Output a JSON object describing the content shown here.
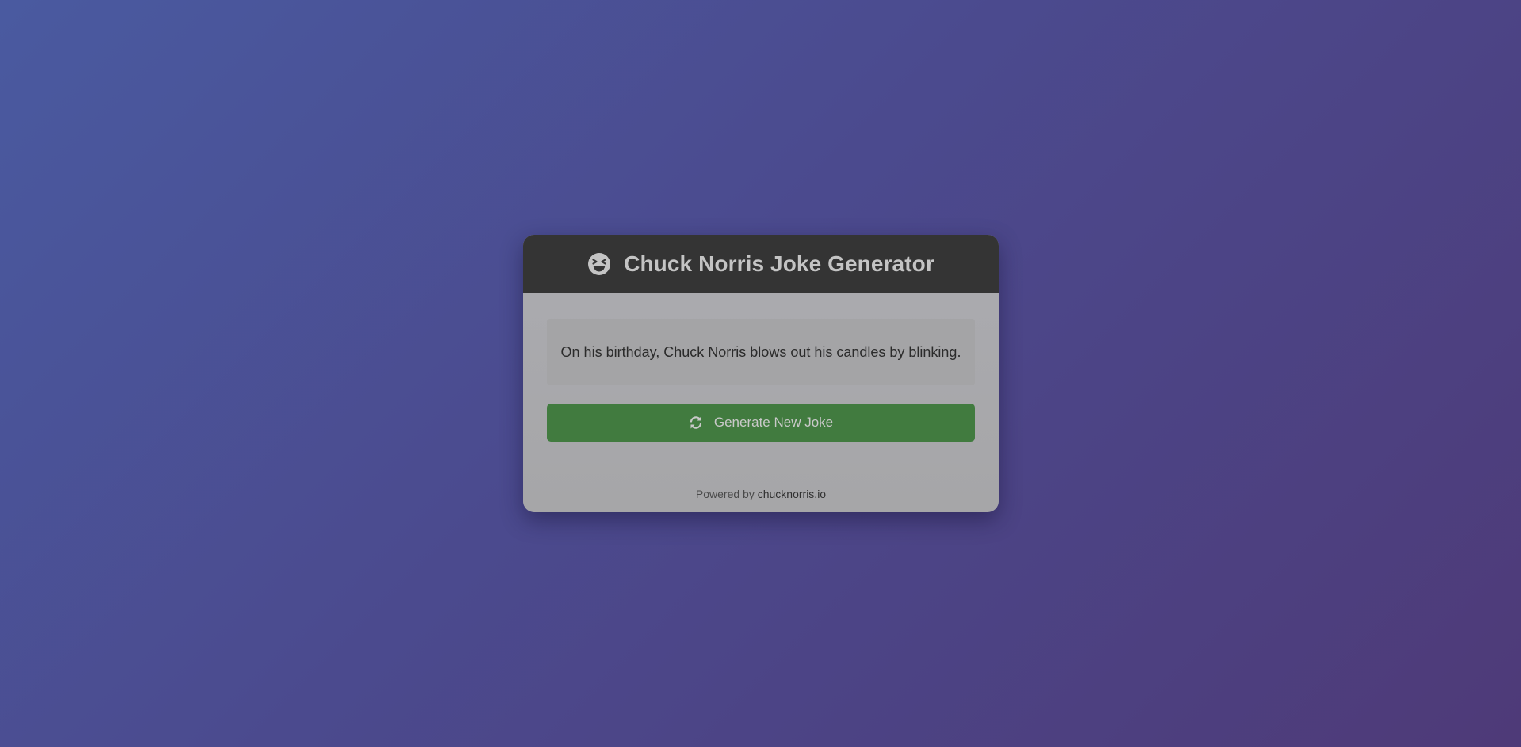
{
  "header": {
    "icon": "laughing-face-icon",
    "title": "Chuck Norris Joke Generator"
  },
  "joke": {
    "text": "On his birthday, Chuck Norris blows out his candles by blinking."
  },
  "button": {
    "icon": "refresh-icon",
    "label": "Generate New Joke"
  },
  "footer": {
    "prefix": "Powered by",
    "link_text": "chucknorris.io"
  },
  "colors": {
    "header_bg": "#343434",
    "button_bg": "#417b3f",
    "page_gradient_start": "#4a5aa0",
    "page_gradient_end": "#4e3a78"
  }
}
